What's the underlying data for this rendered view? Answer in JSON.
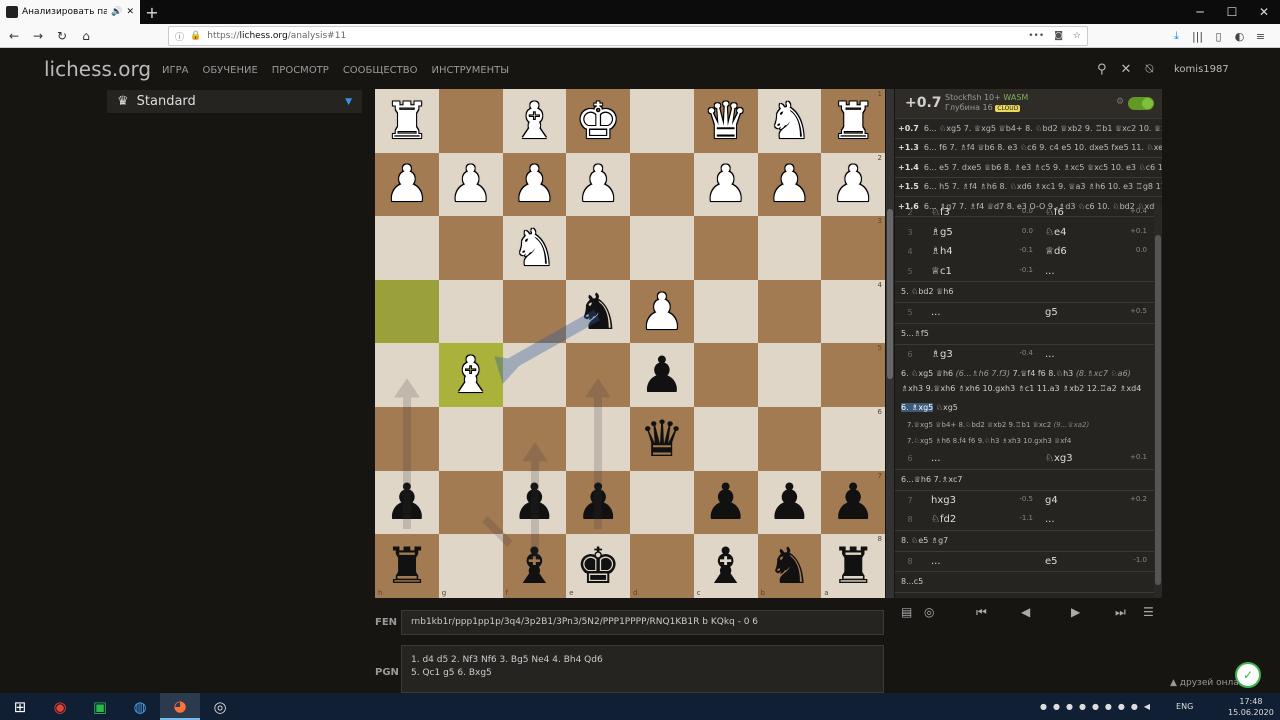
{
  "browser": {
    "tab_title": "Анализировать партию •",
    "url_prefix": "https://",
    "url_host": "lichess.org",
    "url_path": "/analysis#11"
  },
  "site": {
    "logo": "lichess.org",
    "menu": [
      "ИГРА",
      "ОБУЧЕНИЕ",
      "ПРОСМОТР",
      "СООБЩЕСТВО",
      "ИНСТРУМЕНТЫ"
    ],
    "username": "komis1987"
  },
  "variant": {
    "label": "Standard"
  },
  "board": {
    "rows": [
      [
        "wR",
        "",
        "wB",
        "wK",
        "",
        "wQ",
        "wN",
        "wR"
      ],
      [
        "wP",
        "wP",
        "wP",
        "wP",
        "",
        "wP",
        "wP",
        "wP"
      ],
      [
        "",
        "",
        "wN",
        "",
        "",
        "",
        "",
        ""
      ],
      [
        "",
        "",
        "",
        "bN",
        "wP",
        "",
        "",
        ""
      ],
      [
        "",
        "wB",
        "",
        "",
        "bP",
        "",
        "",
        ""
      ],
      [
        "",
        "",
        "",
        "",
        "bQ",
        "",
        "",
        ""
      ],
      [
        "bP",
        "",
        "bP",
        "bP",
        "",
        "bP",
        "bP",
        "bP"
      ],
      [
        "bR",
        "",
        "bB",
        "bK",
        "",
        "bB",
        "bN",
        "bR"
      ]
    ],
    "ranks": [
      "1",
      "2",
      "3",
      "4",
      "5",
      "6",
      "7",
      "8"
    ],
    "files": [
      "h",
      "g",
      "f",
      "e",
      "d",
      "c",
      "b",
      "a"
    ]
  },
  "engine": {
    "eval": "+0.7",
    "name": "Stockfish 10+",
    "name_suffix": "WASM",
    "depth": "Глубина 16",
    "cloud": "CLOUD"
  },
  "pv_lines": [
    {
      "eval": "+0.7",
      "line": "6... ♘xg5 7. ♕xg5 ♕b4+ 8. ♘bd2 ♕xb2 9. ♖b1 ♕xc2 10. ♕xd..."
    },
    {
      "eval": "+1.3",
      "line": "6... f6 7. ♗f4 ♕b6 8. e3 ♘c6 9. c4 e5 10. dxe5 fxe5 11. ♘xe5"
    },
    {
      "eval": "+1.4",
      "line": "6... e5 7. dxe5 ♕b6 8. ♗e3 ♗c5 9. ♗xc5 ♕xc5 10. e3 ♘c6 11. ..."
    },
    {
      "eval": "+1.5",
      "line": "6... h5 7. ♗f4 ♗h6 8. ♘xd6 ♗xc1 9. ♕a3 ♗h6 10. e3 ♖g8 11. ..."
    },
    {
      "eval": "+1.6",
      "line": "6... ♗g7 7. ♗f4 ♕d7 8. e3 O-O 9. ♗d3 ♘c6 10. ♘bd2 ♘xd2 1..."
    }
  ],
  "moves": {
    "rows_a": [
      {
        "n": "2",
        "w": "♘f3",
        "we": "0.0",
        "b": "♘f6",
        "be": "+0.4"
      },
      {
        "n": "3",
        "w": "♗g5",
        "we": "0.0",
        "b": "♘e4",
        "be": "+0.1"
      },
      {
        "n": "4",
        "w": "♗h4",
        "we": "-0.1",
        "b": "♕d6",
        "be": "0.0"
      },
      {
        "n": "5",
        "w": "♕c1",
        "we": "-0.1",
        "b": "...",
        "be": ""
      }
    ],
    "var1": "5. ♘bd2 ♕h6",
    "row5b": {
      "n": "5",
      "w": "...",
      "we": "",
      "b": "g5",
      "be": "+0.5"
    },
    "var2": "5...♗f5",
    "row6": {
      "n": "6",
      "w": "♗g3",
      "we": "-0.4",
      "b": "...",
      "be": ""
    },
    "comment_main": "6. ♘xg5 ♕h6",
    "comment_it1": "(6...♗h6 7.f3)",
    "comment_2": "7.♕f4 f6 8.♘h3",
    "comment_it2": "(8.♗xc7 ♘a6)",
    "comment_3": "♗xh3 9.♕xh6 ♗xh6 10.gxh3 ♗c1 11.a3 ♗xb2 12.♖a2 ♗xd4",
    "current_move": "6. ♗xg5",
    "current_reply": "♘xg5",
    "sub1": "7.♕xg5 ♕b4+ 8.♘bd2 ♕xb2 9.♖b1 ♕xc2",
    "sub1_it": "(9...♕xa2)",
    "sub2": "7.♘xg5 ♗h6 8.f4 f6 9.♘h3 ♗xh3 10.gxh3 ♕xf4",
    "row6b": {
      "n": "6",
      "w": "...",
      "we": "",
      "b": "♘xg3",
      "be": "+0.1"
    },
    "var3": "6...♕h6 7.♗xc7",
    "row7": {
      "n": "7",
      "w": "hxg3",
      "we": "-0.5",
      "b": "g4",
      "be": "+0.2"
    },
    "row8": {
      "n": "8",
      "w": "♘fd2",
      "we": "-1.1",
      "b": "...",
      "be": ""
    },
    "var4": "8. ♘e5 ♗g7",
    "row8b": {
      "n": "8",
      "w": "...",
      "we": "",
      "b": "e5",
      "be": "-1.0"
    },
    "var5": "8...c5"
  },
  "fen": {
    "label": "FEN",
    "value": "rnb1kb1r/ppp1pp1p/3q4/3p2B1/3Pn3/5N2/PPP1PPPP/RNQ1KB1R b KQkq - 0 6"
  },
  "pgn": {
    "label": "PGN",
    "line1": "1. d4 d5 2. Nf3 Nf6 3. Bg5 Ne4 4. Bh4 Qd6",
    "line2": "5. Qc1 g5 6. Bxg5"
  },
  "friends": "друзей онлайн",
  "clock": {
    "time": "17:48",
    "date": "15.06.2020"
  },
  "lang": "ENG"
}
